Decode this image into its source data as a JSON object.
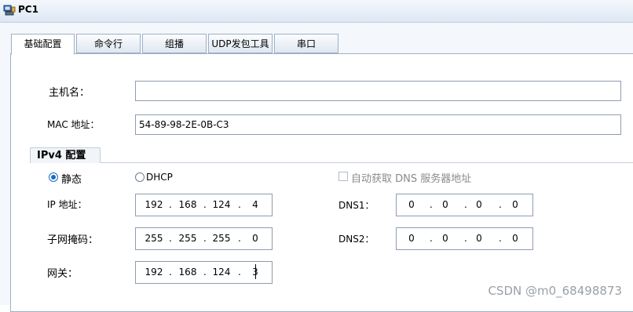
{
  "window": {
    "title": "PC1"
  },
  "tabs": [
    {
      "label": "基础配置",
      "active": true
    },
    {
      "label": "命令行",
      "active": false
    },
    {
      "label": "组播",
      "active": false
    },
    {
      "label": "UDP发包工具",
      "active": false
    },
    {
      "label": "串口",
      "active": false
    }
  ],
  "basic": {
    "hostname_label": "主机名：",
    "hostname_value": "",
    "mac_label": "MAC 地址：",
    "mac_value": "54-89-98-2E-0B-C3"
  },
  "ipv4": {
    "group_label": "IPv4 配置",
    "static_label": "静态",
    "dhcp_label": "DHCP",
    "auto_dns_label": "自动获取 DNS 服务器地址",
    "ip_label": "IP 地址：",
    "ip": [
      "192",
      "168",
      "124",
      "4"
    ],
    "mask_label": "子网掩码：",
    "mask": [
      "255",
      "255",
      "255",
      "0"
    ],
    "gateway_label": "网关：",
    "gateway": [
      "192",
      "168",
      "124",
      "3"
    ],
    "dns1_label": "DNS1：",
    "dns1": [
      "0",
      "0",
      "0",
      "0"
    ],
    "dns2_label": "DNS2：",
    "dns2": [
      "0",
      "0",
      "0",
      "0"
    ],
    "mode": "static"
  },
  "watermark": "CSDN @m0_68498873",
  "colors": {
    "accent": "#1b6dc1",
    "border": "#9fb0c6"
  }
}
